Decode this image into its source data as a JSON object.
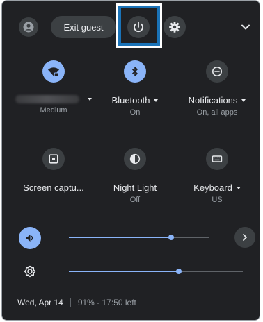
{
  "top_bar": {
    "exit_guest_label": "Exit guest",
    "icons": [
      "avatar-icon",
      "power-icon",
      "gear-icon",
      "chevron-down-icon"
    ]
  },
  "tiles": [
    {
      "label": "",
      "sub": "Medium",
      "icon": "wifi-icon",
      "active": true,
      "has_menu": true
    },
    {
      "label": "Bluetooth",
      "sub": "On",
      "icon": "bluetooth-icon",
      "active": true,
      "has_menu": true
    },
    {
      "label": "Notifications",
      "sub": "On, all apps",
      "icon": "notifications-icon",
      "active": false,
      "has_menu": true
    },
    {
      "label": "Screen captu...",
      "sub": "",
      "icon": "screen-capture-icon",
      "active": false,
      "has_menu": false
    },
    {
      "label": "Night Light",
      "sub": "Off",
      "icon": "night-light-icon",
      "active": false,
      "has_menu": false
    },
    {
      "label": "Keyboard",
      "sub": "US",
      "icon": "keyboard-icon",
      "active": false,
      "has_menu": true
    }
  ],
  "sliders": {
    "volume_level": 0.73,
    "brightness_level": 0.63
  },
  "footer": {
    "date": "Wed, Apr 14",
    "battery": "91% - 17:50 left"
  },
  "colors": {
    "background": "#202124",
    "accent": "#8ab4f8",
    "button": "#3c4043",
    "highlight": "#1a73b8"
  }
}
